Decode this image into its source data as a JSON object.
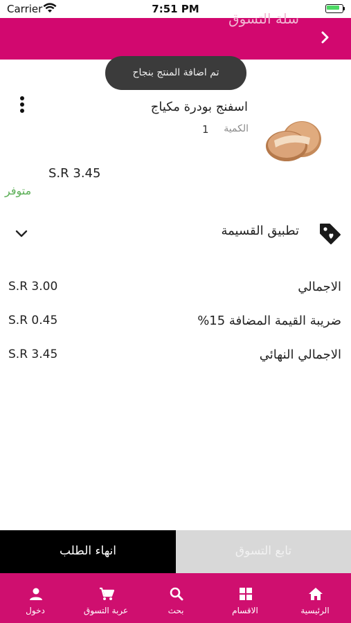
{
  "status_bar": {
    "carrier": "Carrier",
    "time": "7:51 PM"
  },
  "header": {
    "title": "سلة التسوق"
  },
  "toast": {
    "text": "تم اضافة المنتج بنجاح"
  },
  "cart_item": {
    "name": "اسفنج بودرة مكياج",
    "quantity_label": "الكمية",
    "quantity": "1",
    "price": "S.R 3.45",
    "stock_status": "متوفر"
  },
  "coupon": {
    "label": "تطبيق القسيمة"
  },
  "summary": [
    {
      "label": "الاجمالي",
      "value": "S.R 3.00"
    },
    {
      "label": "ضريبة القيمة المضافة 15%",
      "value": "S.R 0.45"
    },
    {
      "label": "الاجمالي النهائي",
      "value": "S.R 3.45"
    }
  ],
  "actions": {
    "checkout": "انهاء الطلب",
    "continue_shopping": "تابع التسوق"
  },
  "tab_bar": {
    "items": [
      {
        "label": "الرئيسية",
        "icon": "home-icon"
      },
      {
        "label": "الاقسام",
        "icon": "grid-icon"
      },
      {
        "label": "بحث",
        "icon": "search-icon"
      },
      {
        "label": "عربة التسوق",
        "icon": "cart-icon"
      },
      {
        "label": "دخول",
        "icon": "person-icon"
      }
    ]
  },
  "colors": {
    "brand": "#d2086f",
    "stock": "#5aae55",
    "checkout_bg": "#000000",
    "continue_bg": "#d8d8d8"
  }
}
